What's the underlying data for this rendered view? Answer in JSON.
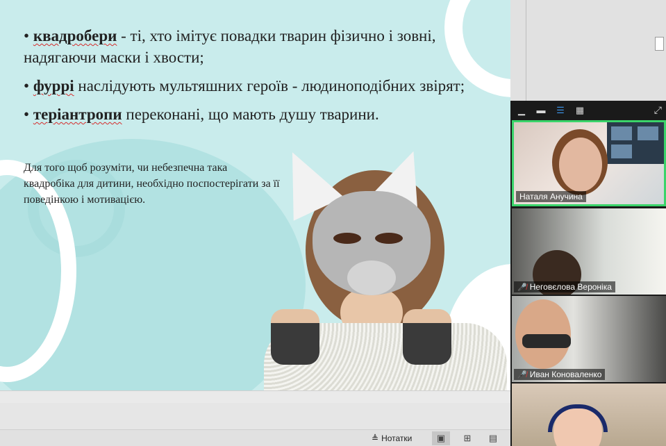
{
  "slide": {
    "bullets": [
      {
        "term": "квадробери",
        "rest": " - ті, хто імітує повадки тварин фізично і зовні, надягаючи маски і хвости;"
      },
      {
        "term": "фуррі",
        "rest": " наслідують мультяшних героїв - людиноподібних звірят;"
      },
      {
        "term": "теріантропи",
        "rest": " переконані, що мають душу тварини."
      }
    ],
    "note": "Для того щоб розуміти, чи небезпечна така квадробіка для дитини, необхідно поспостерігати за її поведінкою і мотивацією."
  },
  "statusbar": {
    "notes_label": "Нотатки",
    "notes_icon": "notes-icon",
    "views": [
      "normal-view-icon",
      "slide-sorter-icon",
      "reading-view-icon"
    ]
  },
  "zoom": {
    "toolbar_icons": [
      "minimize-icon",
      "thumbnail-icon",
      "speaker-view-icon",
      "gallery-view-icon",
      "expand-icon"
    ],
    "participants": [
      {
        "name": "Наталя Анучина",
        "muted": false,
        "active": true
      },
      {
        "name": "Неговєлова Вероніка",
        "muted": true,
        "active": false
      },
      {
        "name": "Иван Коноваленко",
        "muted": true,
        "active": false
      },
      {
        "name": "",
        "muted": false,
        "active": false
      }
    ]
  },
  "colors": {
    "slide_bg": "#c9ecec",
    "active_speaker": "#3ad46a",
    "spellcheck": "#d62b2b"
  }
}
